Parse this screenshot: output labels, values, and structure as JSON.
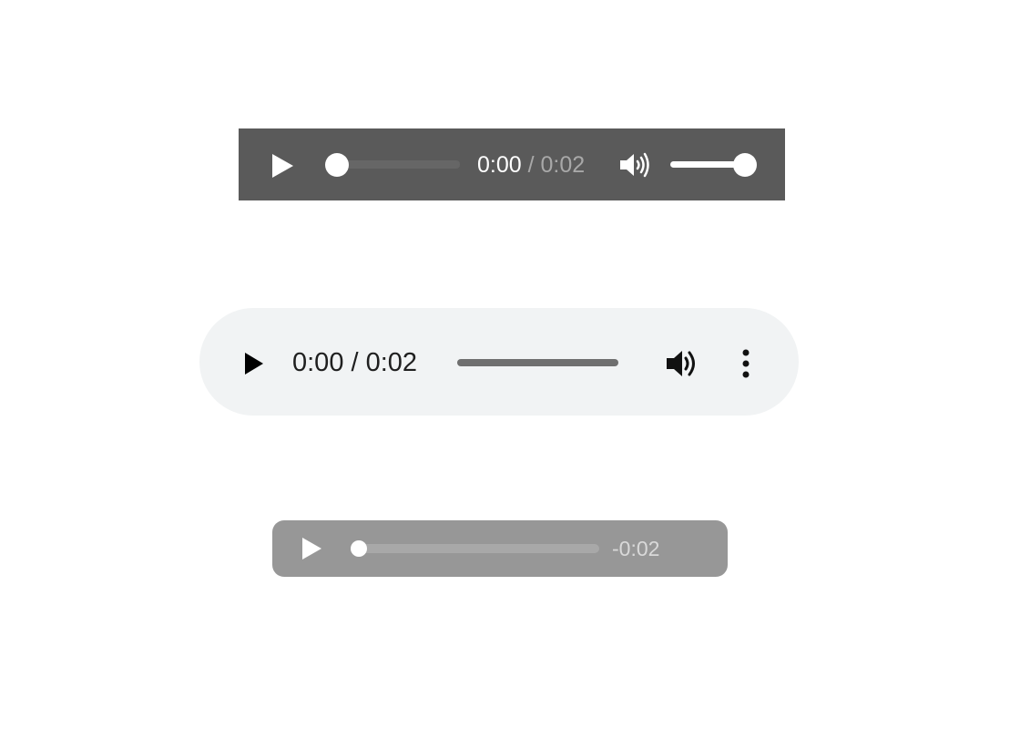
{
  "players": [
    {
      "style": "dark",
      "background": "#5a5a5a",
      "current_time": "0:00",
      "separator": " / ",
      "duration": "0:02",
      "progress": 0.0,
      "volume": 1.0,
      "icons": [
        "play-icon",
        "volume-icon"
      ]
    },
    {
      "style": "light",
      "background": "#f1f3f4",
      "time_display": "0:00 / 0:02",
      "progress": 0.0,
      "icons": [
        "play-icon",
        "volume-icon",
        "more-options-icon"
      ]
    },
    {
      "style": "grey",
      "background": "#979797",
      "remaining_time": "-0:02",
      "progress": 0.0,
      "icons": [
        "play-icon"
      ]
    }
  ]
}
